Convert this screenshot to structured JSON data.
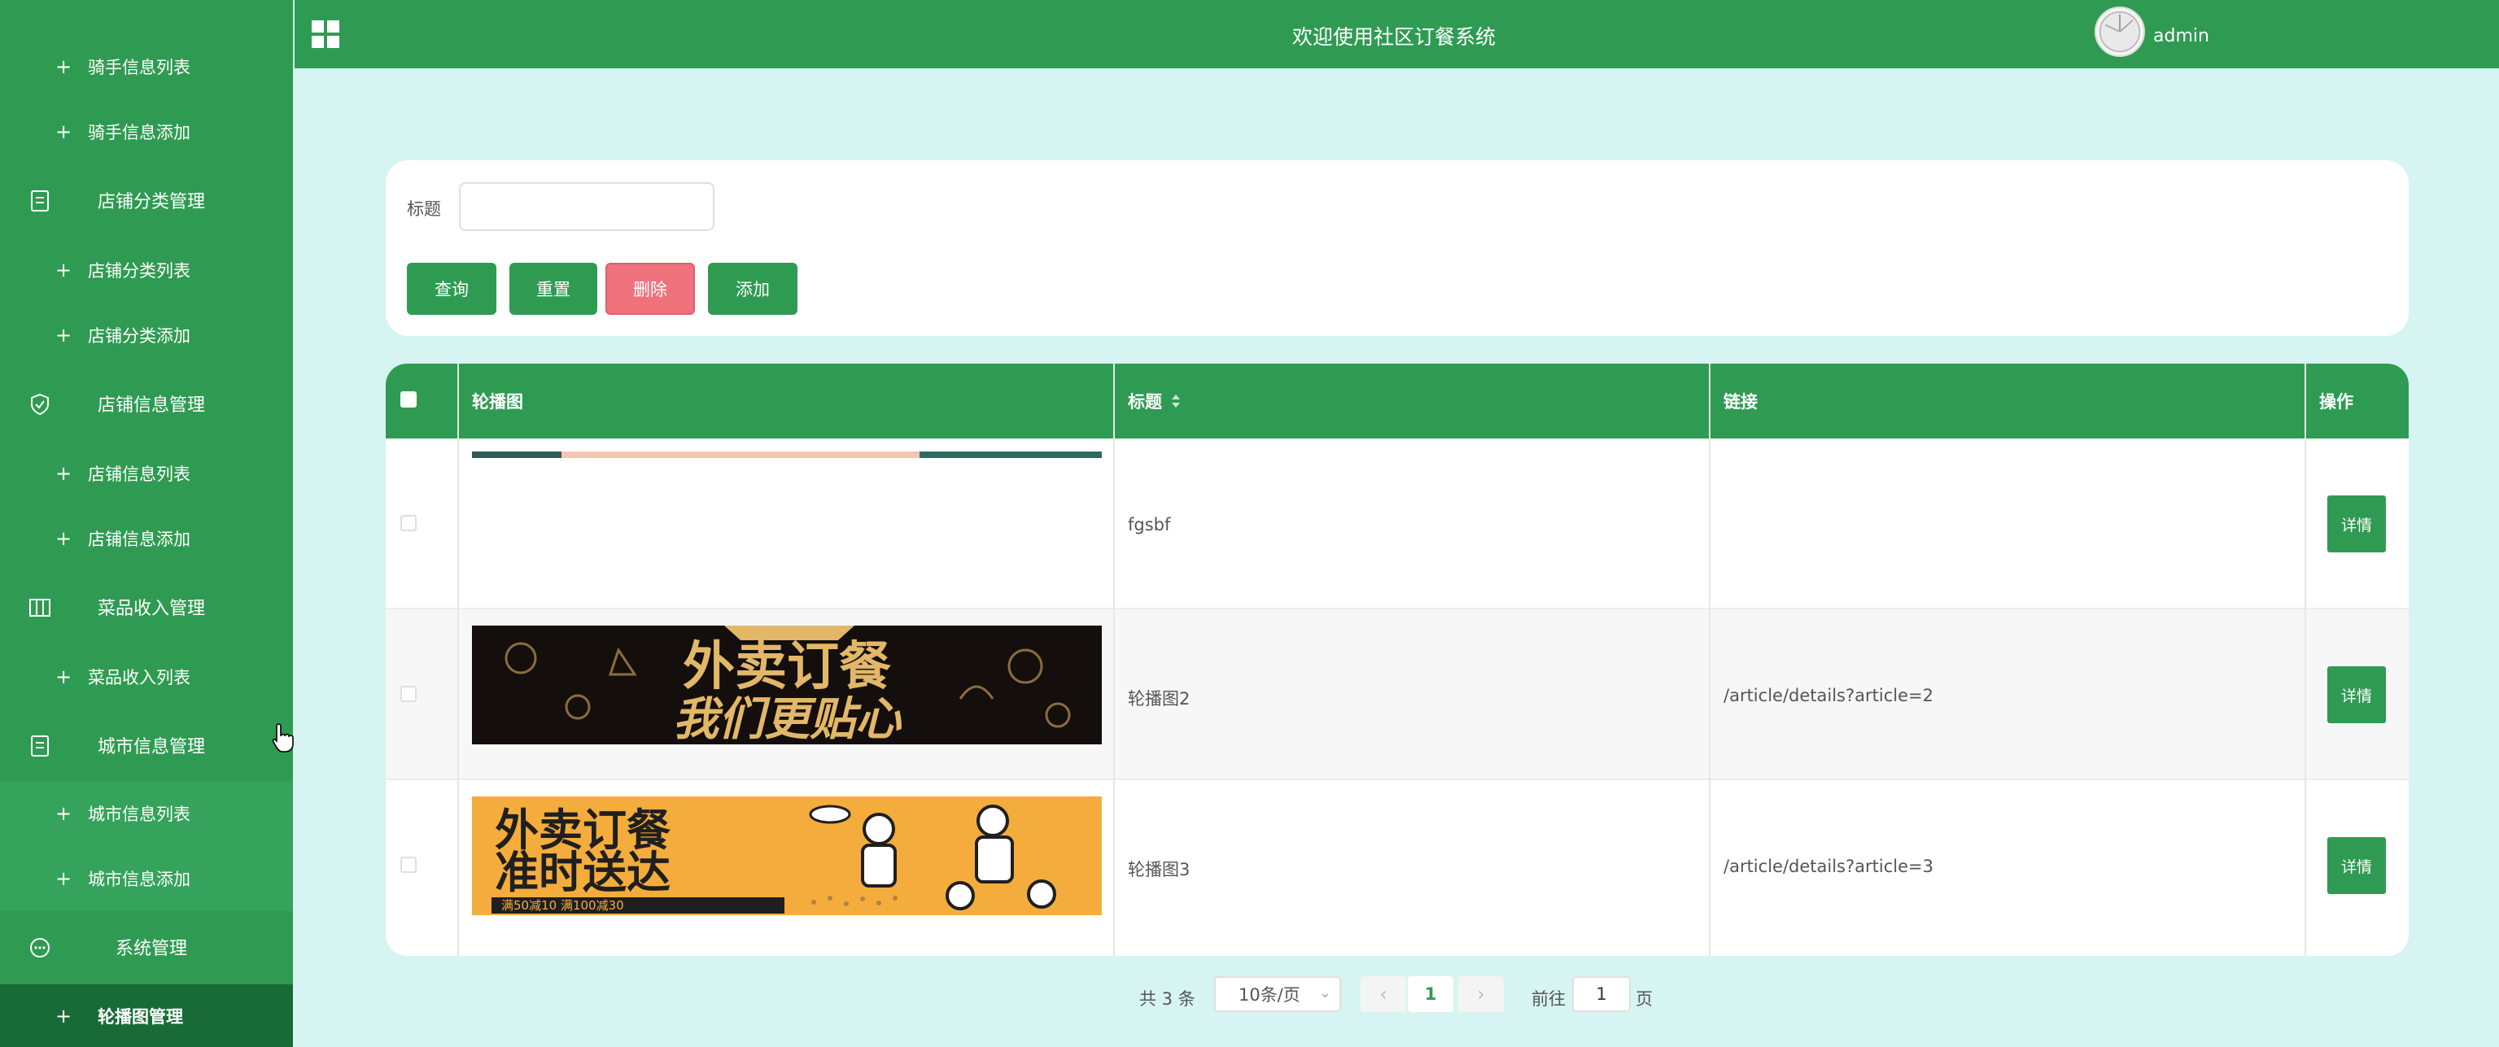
{
  "colors": {
    "primary": "#2f9b52",
    "danger": "#f0727d",
    "background": "#d6f4f2",
    "active_nav": "#186b36"
  },
  "header": {
    "title": "欢迎使用社区订餐系统",
    "username": "admin",
    "menu_icon": "grid-icon"
  },
  "sidebar": {
    "items": [
      {
        "type": "sub",
        "label": "骑手信息列表"
      },
      {
        "type": "sub",
        "label": "骑手信息添加"
      },
      {
        "type": "group",
        "label": "店铺分类管理",
        "icon": "document-icon"
      },
      {
        "type": "sub",
        "label": "店铺分类列表"
      },
      {
        "type": "sub",
        "label": "店铺分类添加"
      },
      {
        "type": "group",
        "label": "店铺信息管理",
        "icon": "shield-icon"
      },
      {
        "type": "sub",
        "label": "店铺信息列表"
      },
      {
        "type": "sub",
        "label": "店铺信息添加"
      },
      {
        "type": "group",
        "label": "菜品收入管理",
        "icon": "columns-icon"
      },
      {
        "type": "sub",
        "label": "菜品收入列表"
      },
      {
        "type": "group",
        "label": "城市信息管理",
        "icon": "document-icon"
      },
      {
        "type": "sub",
        "label": "城市信息列表"
      },
      {
        "type": "sub",
        "label": "城市信息添加"
      },
      {
        "type": "group",
        "label": "系统管理",
        "icon": "chat-icon"
      },
      {
        "type": "sub",
        "label": "轮播图管理",
        "active": true
      }
    ]
  },
  "search": {
    "title_label": "标题",
    "title_value": "",
    "buttons": {
      "query": "查询",
      "reset": "重置",
      "delete": "删除",
      "add": "添加"
    }
  },
  "table": {
    "columns": {
      "banner": "轮播图",
      "title": "标题",
      "link": "链接",
      "actions": "操作"
    },
    "rows": [
      {
        "title": "fgsbf",
        "link": "",
        "action": "详情"
      },
      {
        "title": "轮播图2",
        "link": "/article/details?article=2",
        "action": "详情",
        "banner_text_1": "外卖订餐",
        "banner_text_2": "我们更贴心"
      },
      {
        "title": "轮播图3",
        "link": "/article/details?article=3",
        "action": "详情",
        "banner_text_1": "外卖订餐",
        "banner_text_2": "准时送达",
        "banner_text_3": "满50减10  满100减30"
      }
    ]
  },
  "pagination": {
    "total": "共 3 条",
    "page_size": "10条/页",
    "current_page": "1",
    "goto_label": "前往",
    "goto_value": "1",
    "page_suffix": "页"
  }
}
